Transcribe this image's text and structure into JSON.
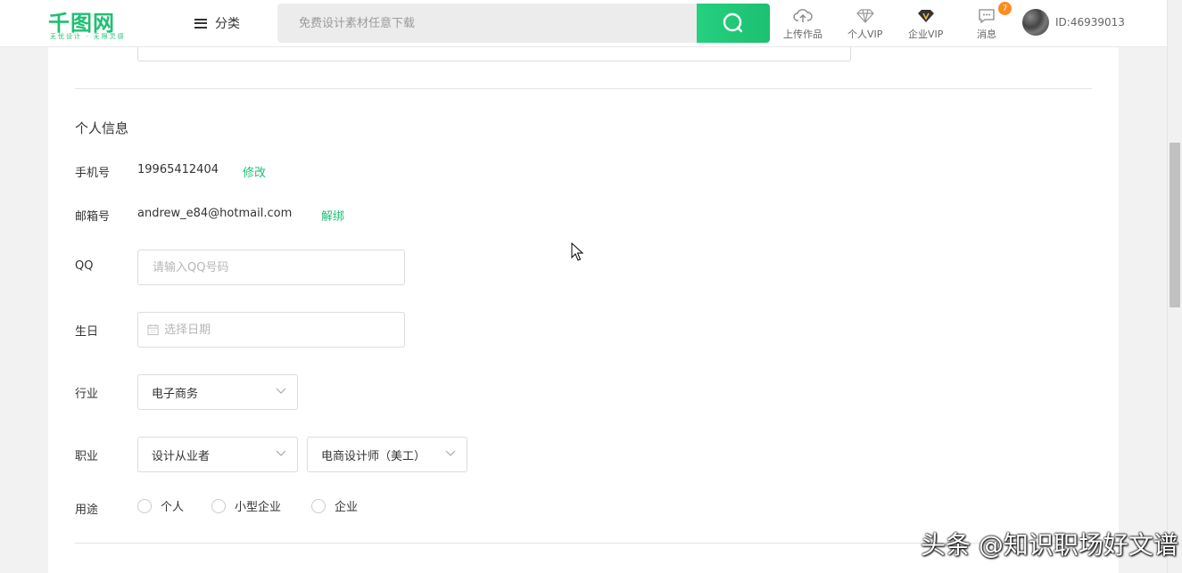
{
  "header": {
    "logo_text": "千图网",
    "logo_slogan": "无忧设计 · 无限灵感",
    "category_label": "分类",
    "search_placeholder": "免费设计素材任意下载",
    "nav": {
      "upload_label": "上传作品",
      "personal_vip_label": "个人VIP",
      "enterprise_vip_label": "企业VIP",
      "messages_label": "消息",
      "messages_badge": "7"
    },
    "user_id": "ID:46939013"
  },
  "personal_info": {
    "section_title": "个人信息",
    "phone": {
      "label": "手机号",
      "value": "19965412404",
      "action": "修改"
    },
    "email": {
      "label": "邮箱号",
      "value": "andrew_e84@hotmail.com",
      "action": "解绑"
    },
    "qq": {
      "label": "QQ",
      "placeholder": "请输入QQ号码"
    },
    "birthday": {
      "label": "生日",
      "placeholder": "选择日期"
    },
    "industry": {
      "label": "行业",
      "selected": "电子商务"
    },
    "occupation": {
      "label": "职业",
      "primary": "设计从业者",
      "secondary": "电商设计师（美工）"
    },
    "usage": {
      "label": "用途",
      "options": [
        "个人",
        "小型企业",
        "企业"
      ]
    }
  },
  "watermark": "头条 @知识职场好文谱",
  "colors": {
    "accent": "#1fbf74",
    "badge": "#ff8a1f"
  }
}
